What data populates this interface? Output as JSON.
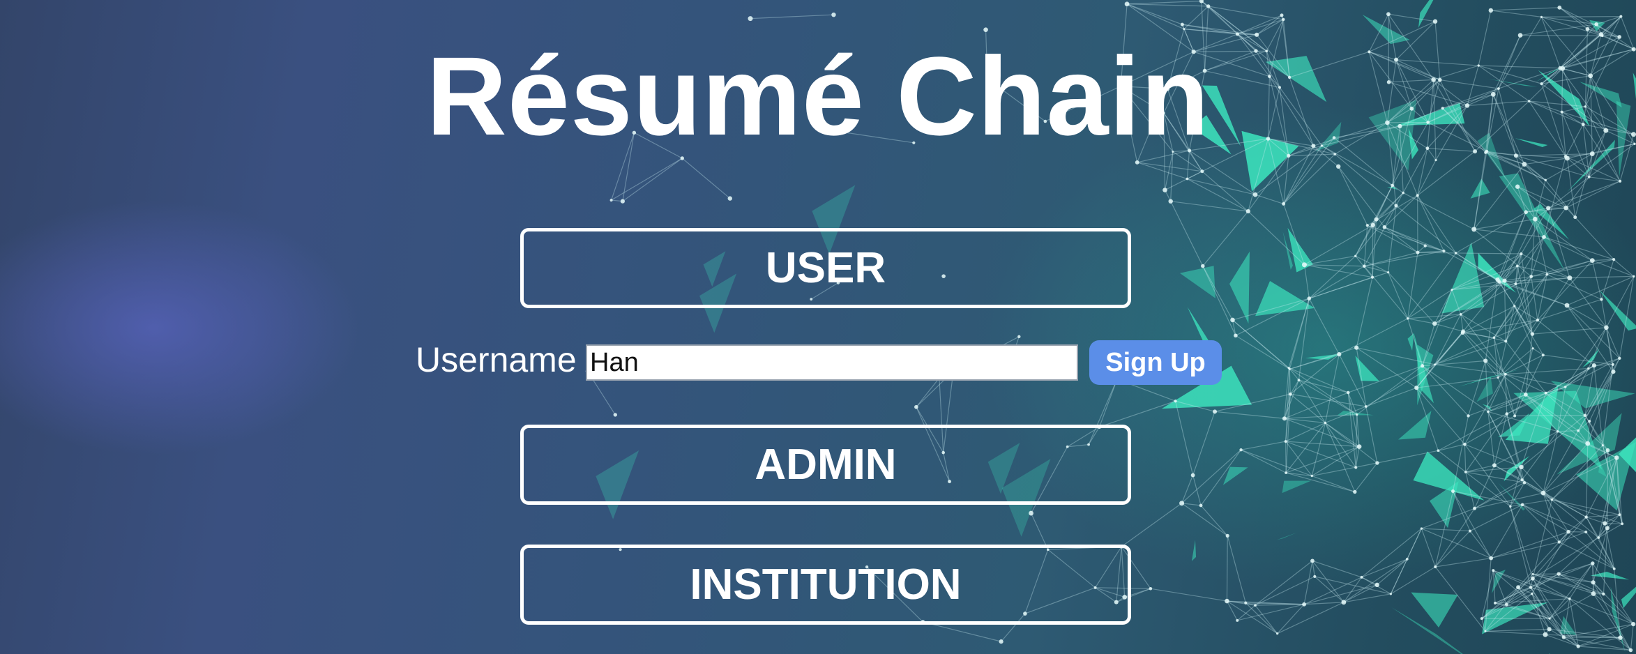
{
  "app": {
    "title": "Résumé Chain"
  },
  "roles": {
    "user_label": "USER",
    "admin_label": "ADMIN",
    "institution_label": "INSTITUTION"
  },
  "signup": {
    "username_label": "Username",
    "username_value": "Han",
    "button_label": "Sign Up"
  },
  "colors": {
    "background_dark": "#2e4a6e",
    "accent_teal": "#3de8c0",
    "signup_button": "#5b8ee8",
    "text": "#ffffff"
  }
}
